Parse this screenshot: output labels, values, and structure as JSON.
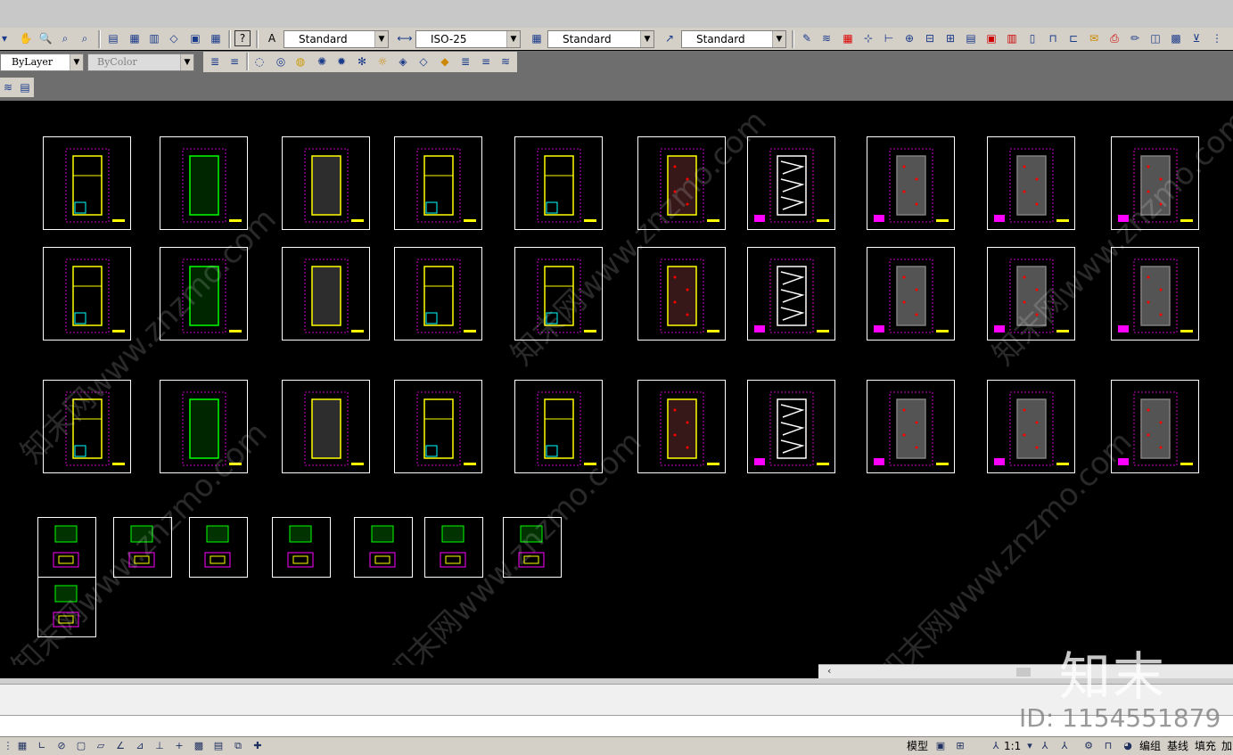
{
  "toolbar1": {
    "text_style": "Standard",
    "dim_style": "ISO-25",
    "table_style": "Standard",
    "multileader_style": "Standard",
    "icons": [
      "pan-icon",
      "zoom-realtime-icon",
      "zoom-window-icon",
      "zoom-previous-icon",
      "properties-icon",
      "design-center-icon",
      "tool-palettes-icon",
      "sheet-set-icon",
      "markup-icon",
      "calculator-icon",
      "help-icon"
    ]
  },
  "toolbar2": {
    "linetype": "ByLayer",
    "color": "ByColor"
  },
  "drawing": {
    "sheet_stroke": "#ffffff",
    "palette": [
      "#ff00ff",
      "#ffff00",
      "#00ff00",
      "#00ffff",
      "#ffffff",
      "#808080",
      "#ff0000"
    ]
  },
  "watermark": {
    "text": "知末网www.znzmo.com",
    "logo": "知末",
    "id": "ID: 1154551879"
  },
  "status": {
    "model_tab": "模型",
    "scale": "1:1",
    "group_label": "编组",
    "baseline_label": "基线",
    "fill_label": "填充",
    "add_label": "加"
  }
}
